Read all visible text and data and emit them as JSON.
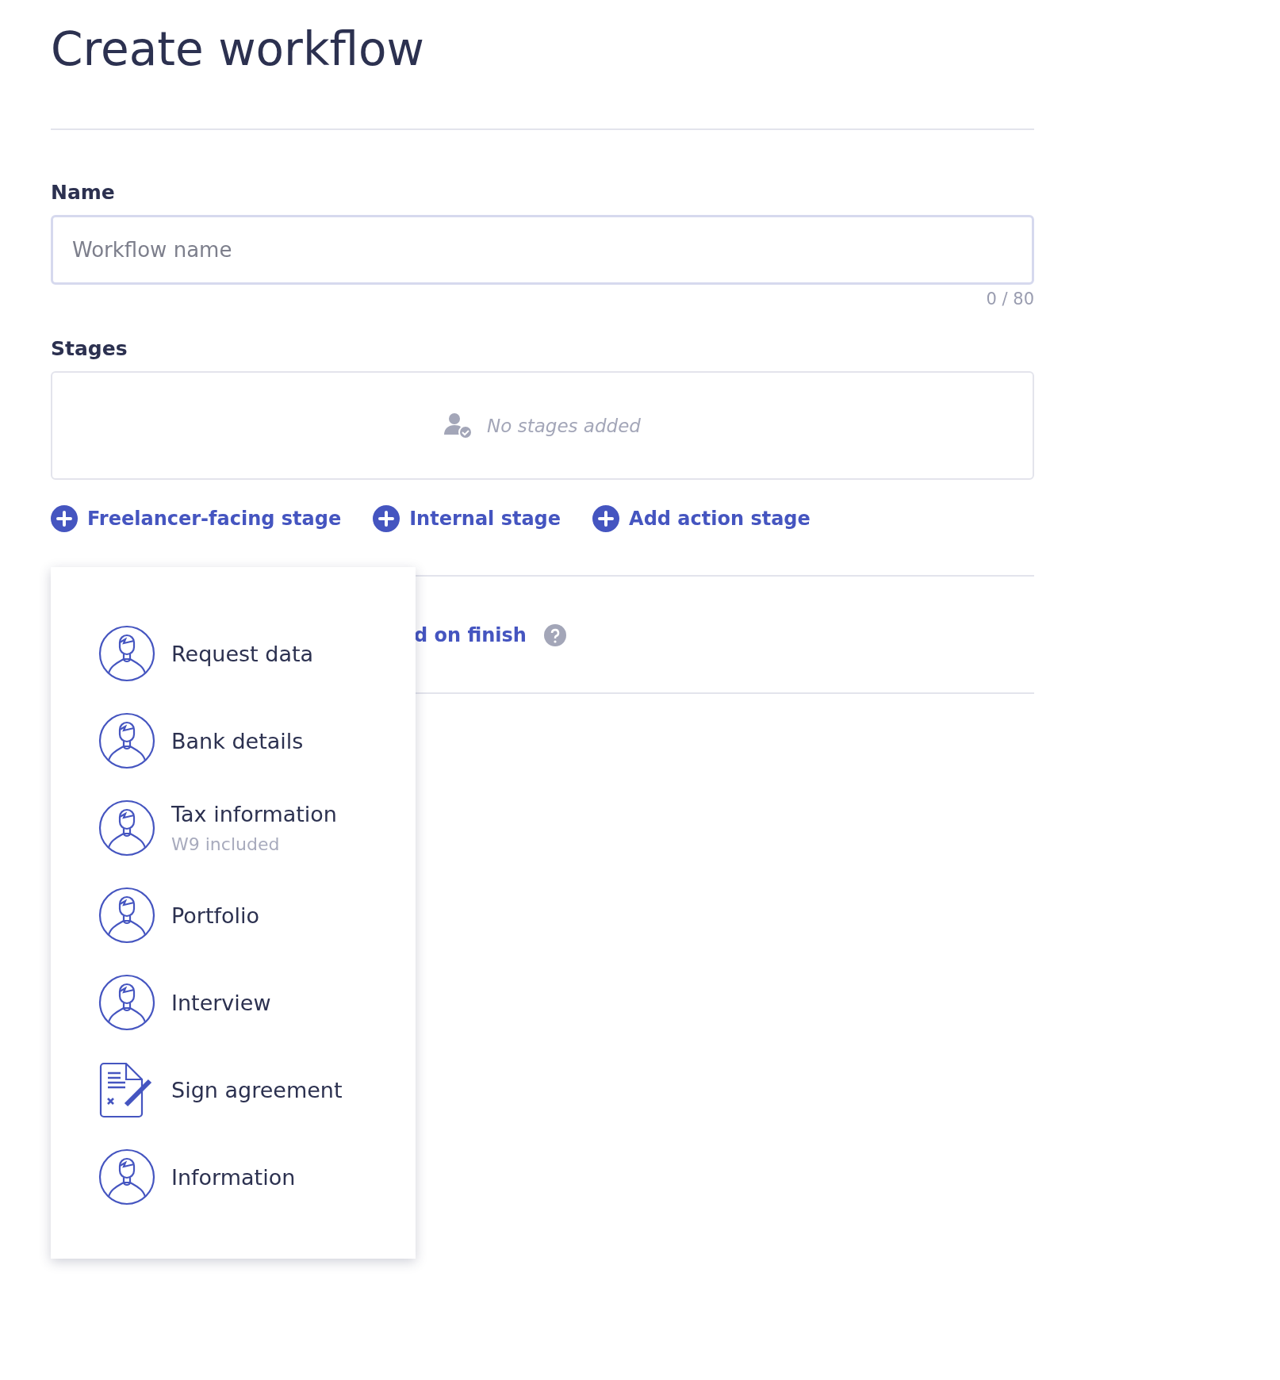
{
  "page": {
    "title": "Create workflow"
  },
  "name_field": {
    "label": "Name",
    "placeholder": "Workflow name",
    "counter": "0 / 80"
  },
  "stages": {
    "label": "Stages",
    "empty_text": "No stages added"
  },
  "add_buttons": [
    {
      "label": "Freelancer-facing stage"
    },
    {
      "label": "Internal stage"
    },
    {
      "label": "Add action stage"
    }
  ],
  "setting": {
    "link": "d on finish"
  },
  "dropdown": {
    "items": [
      {
        "kind": "person",
        "label": "Request data"
      },
      {
        "kind": "person",
        "label": "Bank details"
      },
      {
        "kind": "person",
        "label": "Tax information",
        "note": "W9 included"
      },
      {
        "kind": "person",
        "label": "Portfolio"
      },
      {
        "kind": "person",
        "label": "Interview"
      },
      {
        "kind": "document",
        "label": "Sign agreement"
      },
      {
        "kind": "person",
        "label": "Information"
      }
    ]
  }
}
